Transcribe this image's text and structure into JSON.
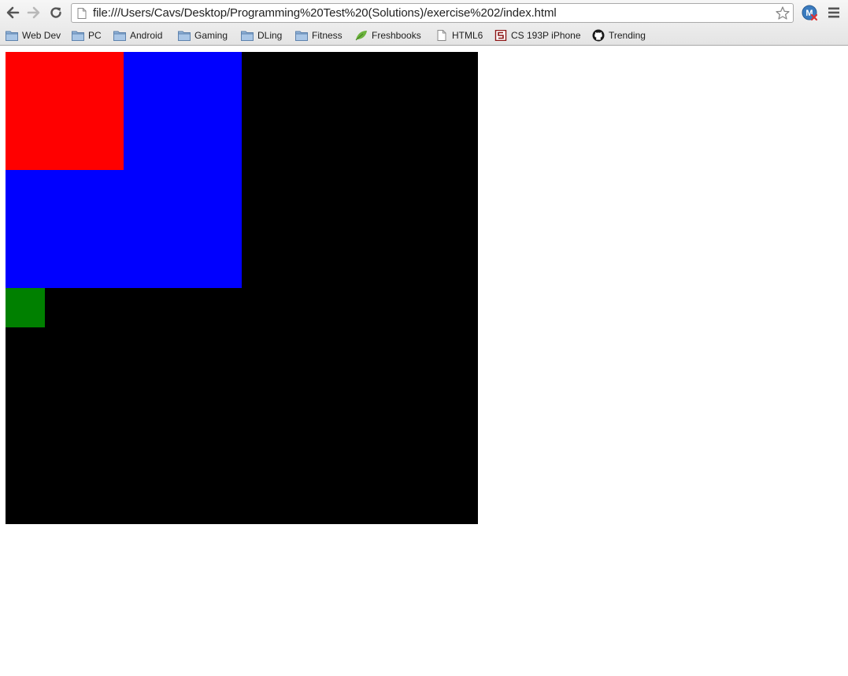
{
  "browser": {
    "url": "file:///Users/Cavs/Desktop/Programming%20Test%20(Solutions)/exercise%202/index.html",
    "icons": [
      "back-arrow-icon",
      "forward-arrow-icon",
      "reload-icon",
      "page-icon",
      "star-icon",
      "extension-icon",
      "menu-icon"
    ]
  },
  "bookmarks": [
    {
      "label": "Web Dev",
      "icon": "folder-icon"
    },
    {
      "label": "PC",
      "icon": "folder-icon"
    },
    {
      "label": "Android",
      "icon": "folder-icon"
    },
    {
      "label": "Gaming",
      "icon": "folder-icon"
    },
    {
      "label": "DLing",
      "icon": "folder-icon"
    },
    {
      "label": "Fitness",
      "icon": "folder-icon"
    },
    {
      "label": "Freshbooks",
      "icon": "leaf-icon"
    },
    {
      "label": "HTML6",
      "icon": "page-icon"
    },
    {
      "label": "CS 193P iPhone",
      "icon": "stanford-icon"
    },
    {
      "label": "Trending",
      "icon": "github-icon"
    }
  ],
  "page": {
    "canvas_color": "#000000",
    "shapes": [
      {
        "name": "blue-square",
        "color": "#0000ff"
      },
      {
        "name": "red-square",
        "color": "#ff0000"
      },
      {
        "name": "green-square",
        "color": "#008000"
      }
    ]
  }
}
